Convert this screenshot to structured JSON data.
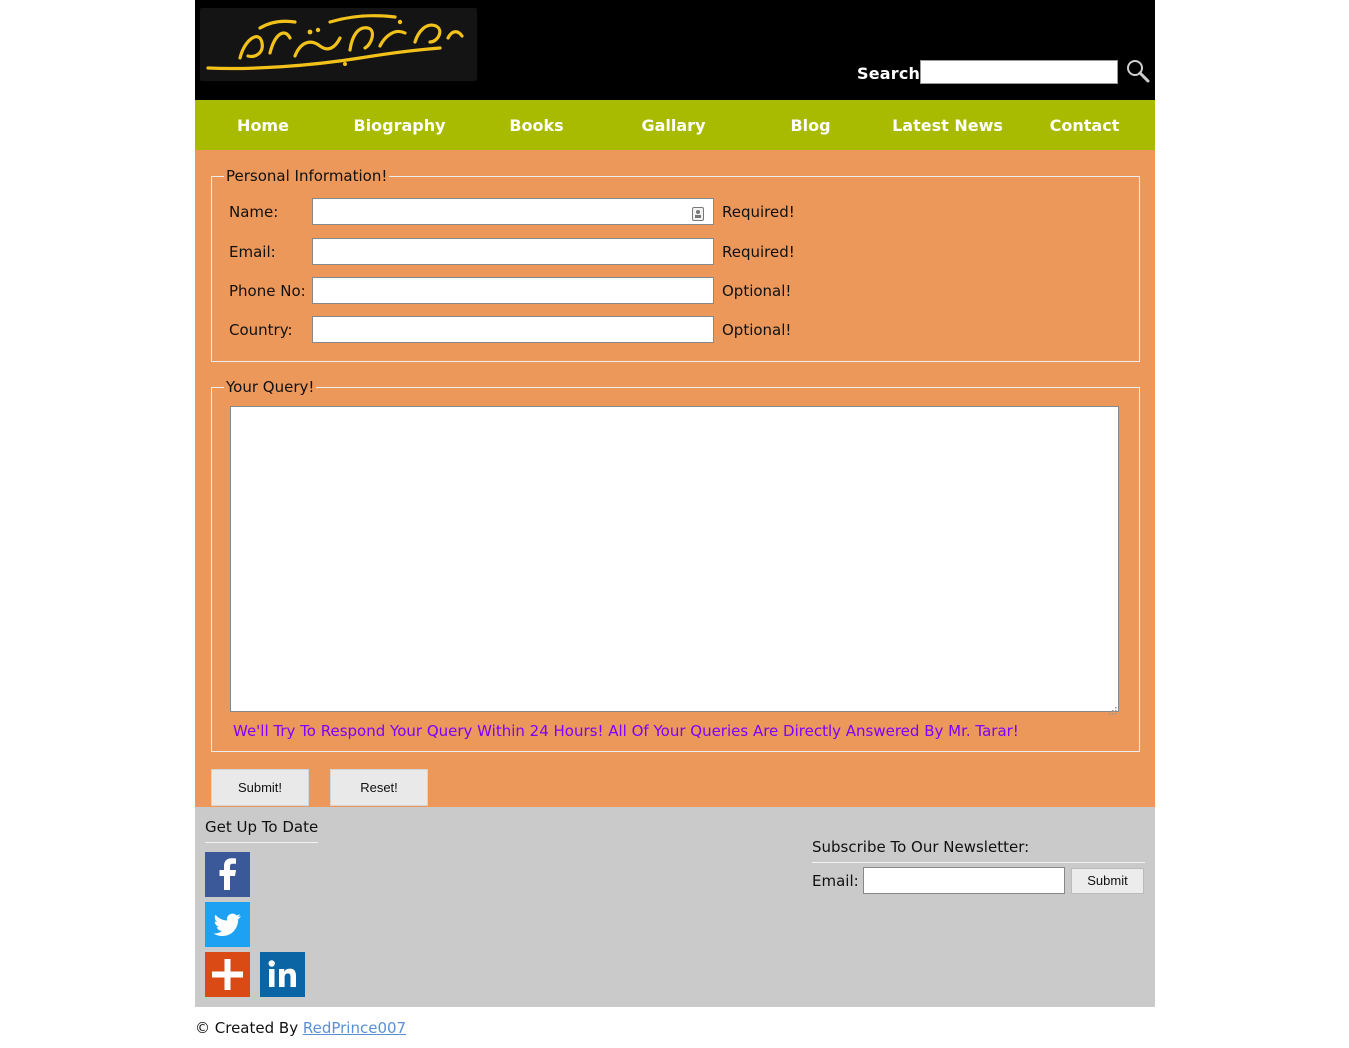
{
  "header": {
    "logo_alt": "مستنصر حسین تارڑ",
    "search_label": "Search:",
    "search_value": ""
  },
  "nav": {
    "items": [
      {
        "label": "Home"
      },
      {
        "label": "Biography"
      },
      {
        "label": "Books"
      },
      {
        "label": "Gallary"
      },
      {
        "label": "Blog"
      },
      {
        "label": "Latest News"
      },
      {
        "label": "Contact"
      }
    ]
  },
  "personal": {
    "legend": "Personal Information!",
    "fields": [
      {
        "label": "Name:",
        "value": "",
        "note": "Required!"
      },
      {
        "label": "Email:",
        "value": "",
        "note": "Required!"
      },
      {
        "label": "Phone No:",
        "value": "",
        "note": "Optional!"
      },
      {
        "label": "Country:",
        "value": "",
        "note": "Optional!"
      }
    ]
  },
  "query": {
    "legend": "Your Query!",
    "value": "",
    "note": "We'll Try To Respond Your Query Within 24 Hours! All Of Your Queries Are Directly Answered By Mr. Tarar!"
  },
  "buttons": {
    "submit": "Submit!",
    "reset": "Reset!"
  },
  "footer": {
    "up_to_date_heading": "Get Up To Date",
    "social": [
      {
        "icon": "facebook-icon"
      },
      {
        "icon": "twitter-icon"
      },
      {
        "icon": "addthis-icon"
      },
      {
        "icon": "linkedin-icon"
      }
    ],
    "newsletter_heading": "Subscribe To Our Newsletter:",
    "newsletter_email_label": "Email:",
    "newsletter_value": "",
    "newsletter_submit": "Submit"
  },
  "credit": {
    "prefix": "© Created By ",
    "link": "RedPrince007"
  },
  "colors": {
    "nav_bg": "#a9bb00",
    "form_bg": "#ec985b",
    "footer_bg": "#cacaca",
    "note_text": "#7b00ff",
    "logo_gold": "#f2c21b"
  }
}
